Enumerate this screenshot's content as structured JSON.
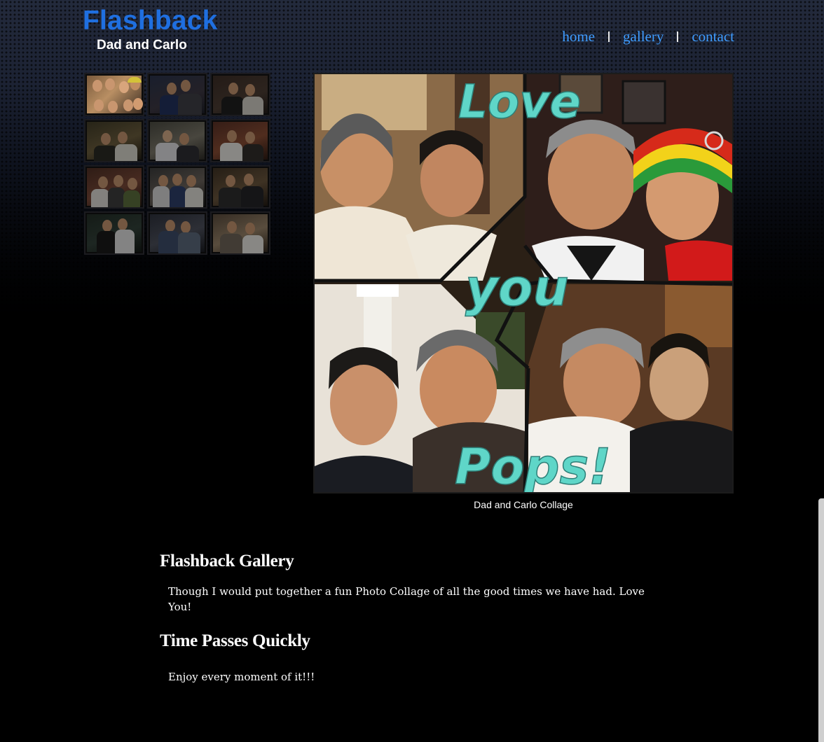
{
  "header": {
    "title": "Flashback",
    "subtitle": "Dad and Carlo"
  },
  "nav": {
    "items": [
      {
        "label": "home"
      },
      {
        "label": "gallery"
      },
      {
        "label": "contact"
      }
    ]
  },
  "gallery": {
    "main_caption": "Dad and Carlo Collage",
    "collage_text": {
      "word1": "Love",
      "word2": "you",
      "word3": "Pops!"
    },
    "thumbnail_count": 12,
    "active_thumbnail": 1
  },
  "content": {
    "sections": [
      {
        "heading": "Flashback Gallery",
        "body": "Though I would put together a fun Photo Collage of all the good times we have had. Love You!"
      },
      {
        "heading": "Time Passes Quickly",
        "body": "Enjoy every moment of it!!!"
      }
    ]
  },
  "colors": {
    "title": "#1f6fe0",
    "nav_link": "#3f9cff",
    "collage_text": "#5fd6c8"
  }
}
